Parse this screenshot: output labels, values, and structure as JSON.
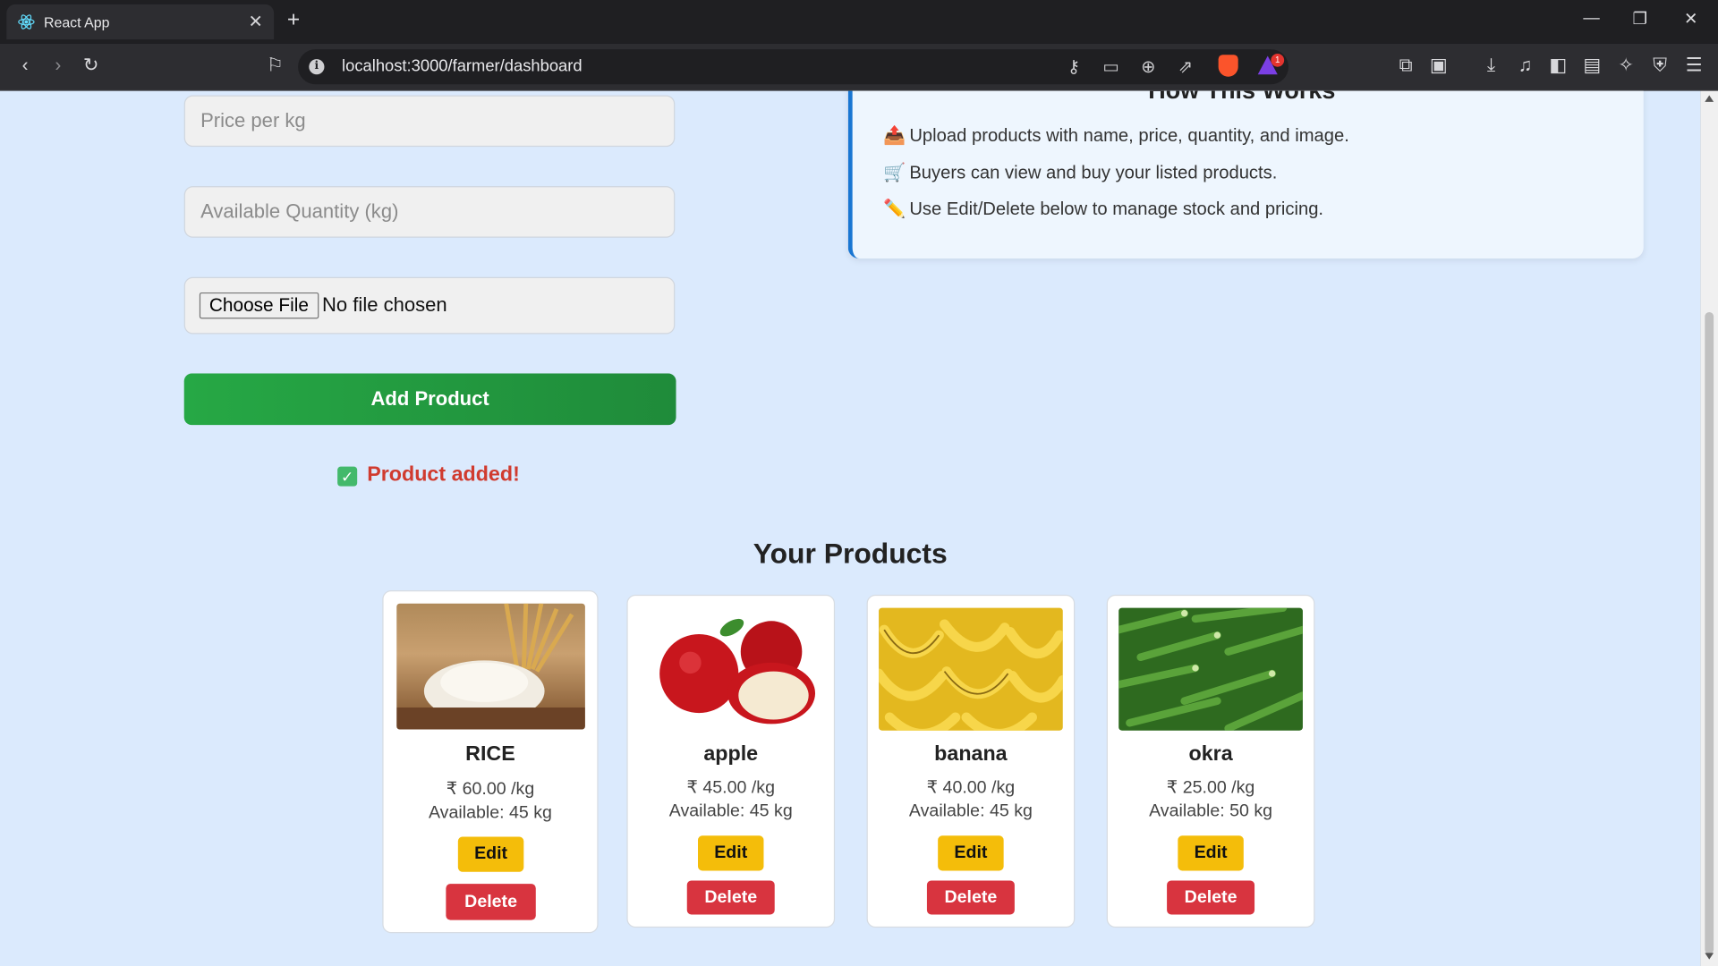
{
  "browser": {
    "tab_title": "React App",
    "url": "localhost:3000/farmer/dashboard",
    "rewards_badge": "1"
  },
  "form": {
    "price_placeholder": "Price per kg",
    "quantity_placeholder": "Available Quantity (kg)",
    "choose_file_label": "Choose File",
    "no_file_label": "No file chosen",
    "submit_label": "Add Product",
    "status_message": "Product added!"
  },
  "how_it_works": {
    "title": "How This Works",
    "items": [
      {
        "icon": "upload-icon",
        "text": "Upload products with name, price, quantity, and image."
      },
      {
        "icon": "cart-icon",
        "text": "Buyers can view and buy your listed products."
      },
      {
        "icon": "pencil-icon",
        "text": "Use Edit/Delete below to manage stock and pricing."
      }
    ]
  },
  "products_section": {
    "title": "Your Products",
    "edit_label": "Edit",
    "delete_label": "Delete",
    "products": [
      {
        "name": "RICE",
        "price": "₹ 60.00 /kg",
        "available": "Available: 45 kg"
      },
      {
        "name": "apple",
        "price": "₹ 45.00 /kg",
        "available": "Available: 45 kg"
      },
      {
        "name": "banana",
        "price": "₹ 40.00 /kg",
        "available": "Available: 45 kg"
      },
      {
        "name": "okra",
        "price": "₹ 25.00 /kg",
        "available": "Available: 50 kg"
      }
    ]
  },
  "colors": {
    "page_bg": "#dbeafd",
    "primary_green": "#26a845",
    "edit_yellow": "#f4bd0a",
    "delete_red": "#d8343f",
    "accent_blue": "#1976d2"
  }
}
